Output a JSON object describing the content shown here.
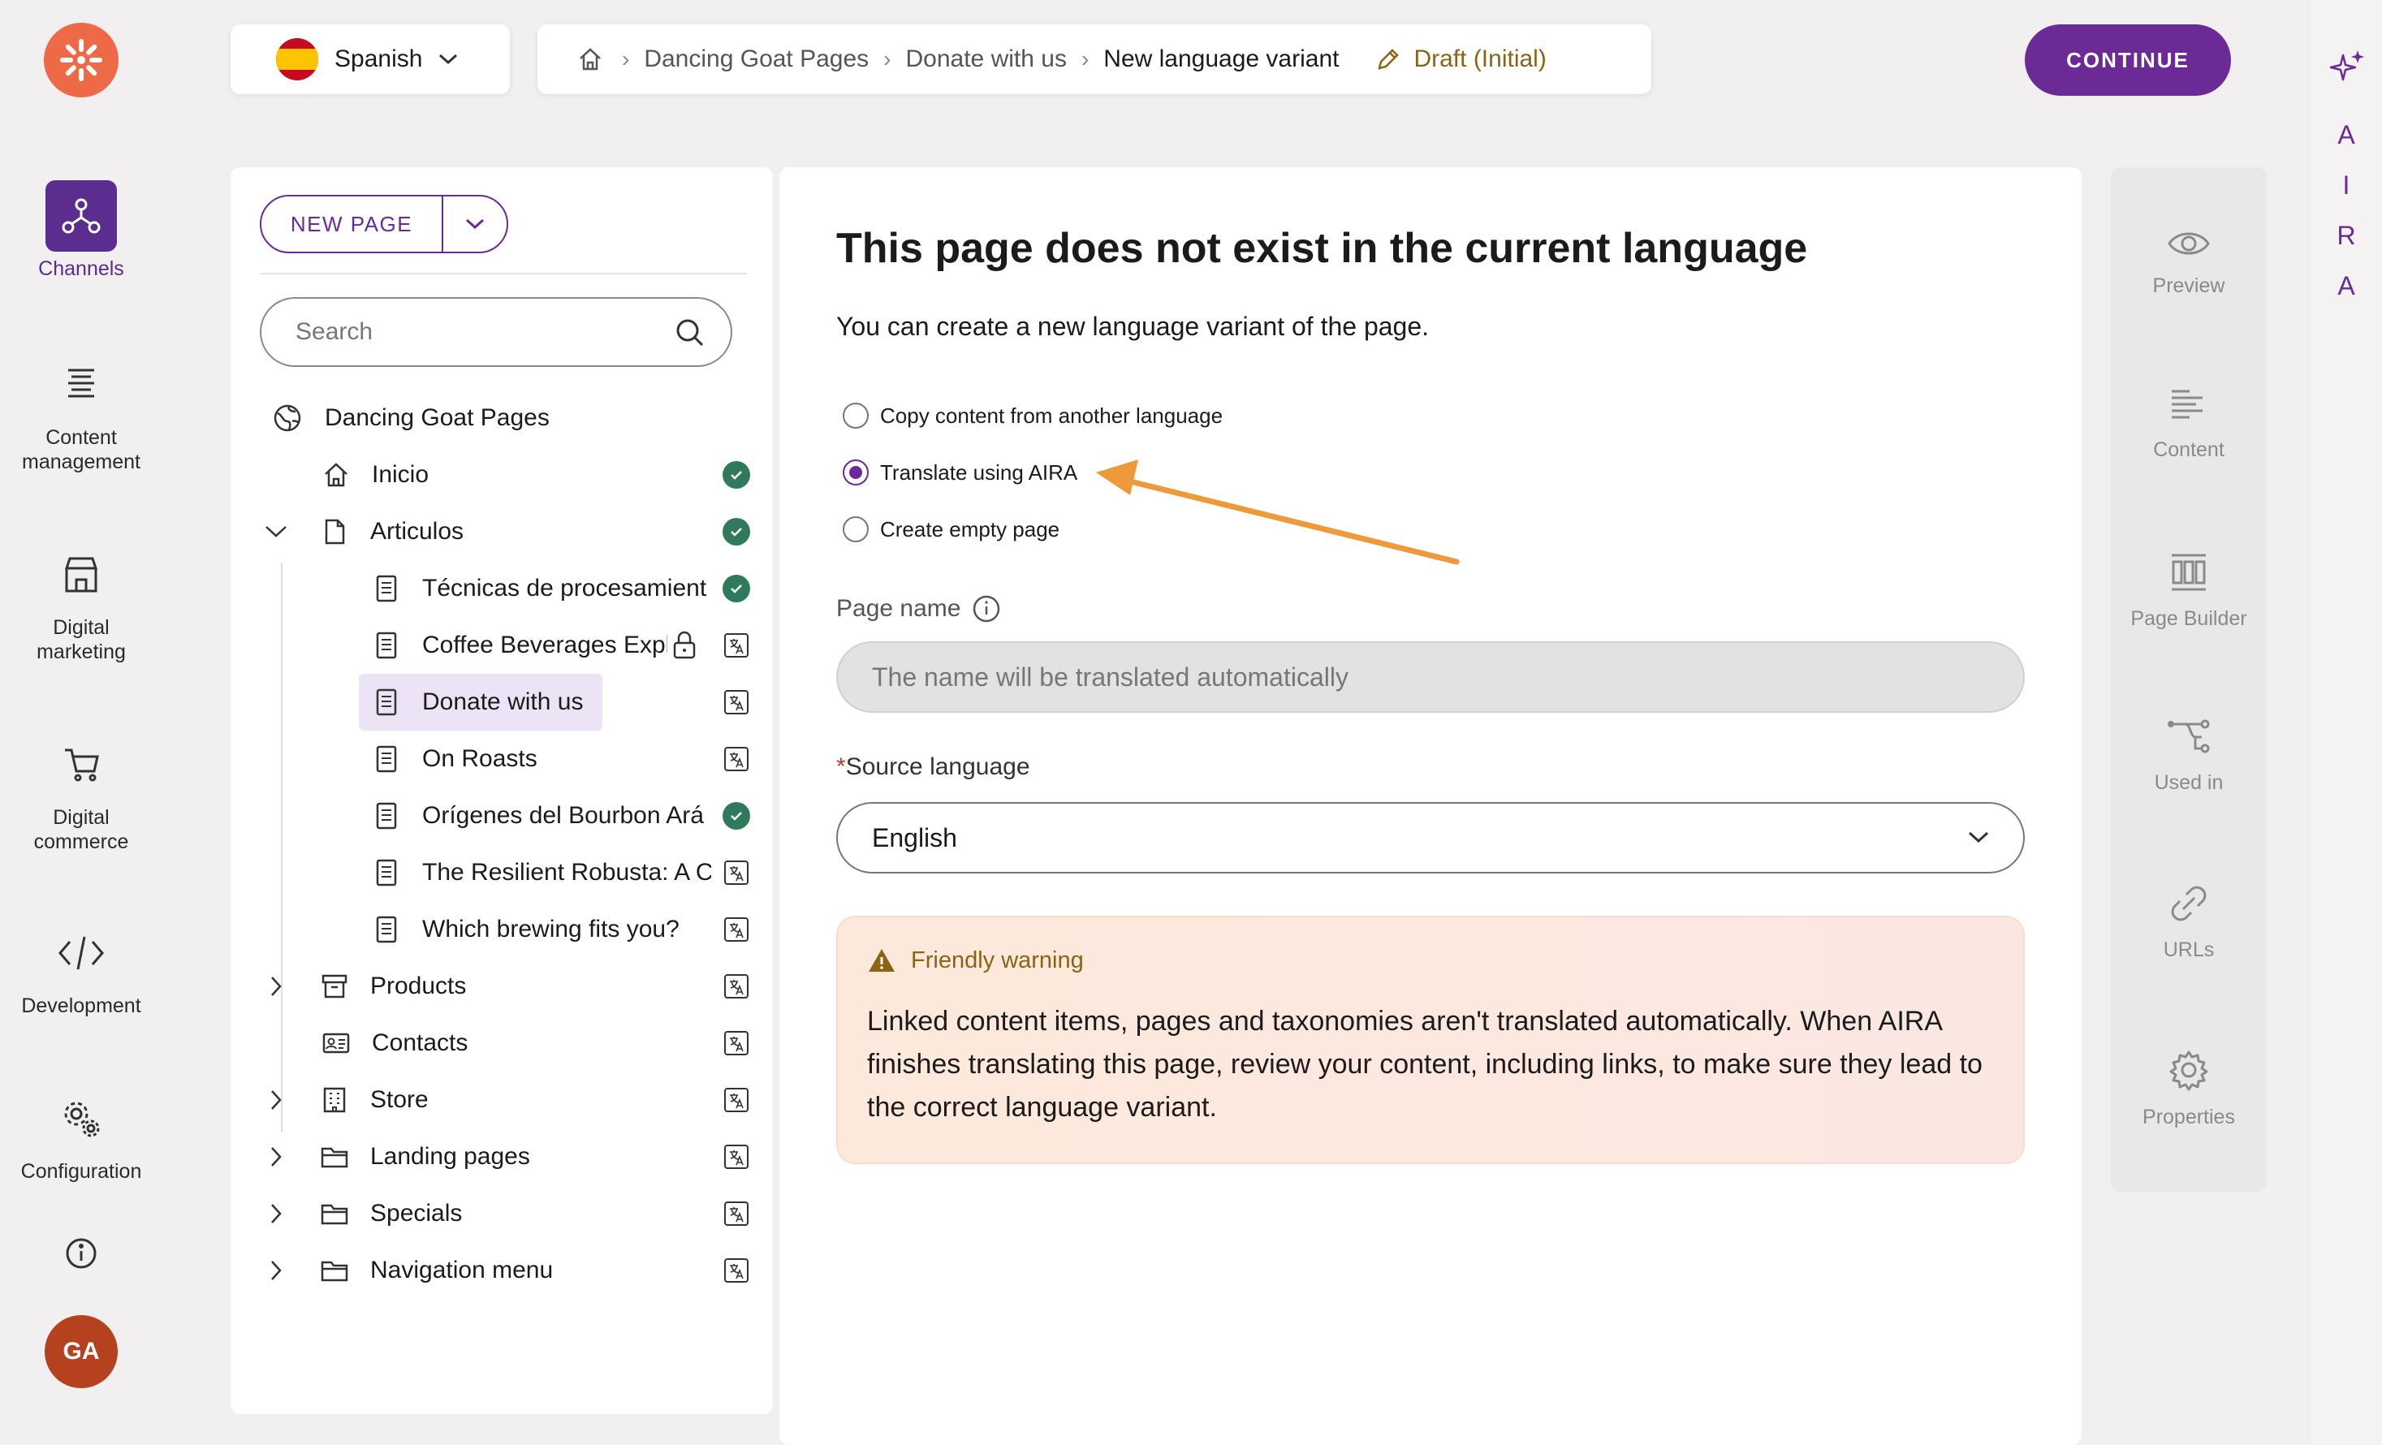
{
  "app": {
    "nav": [
      {
        "label": "Channels",
        "icon": "channels-icon",
        "active": true
      },
      {
        "label": "Content management",
        "icon": "content-management-icon",
        "active": false
      },
      {
        "label": "Digital marketing",
        "icon": "digital-marketing-icon",
        "active": false
      },
      {
        "label": "Digital commerce",
        "icon": "digital-commerce-icon",
        "active": false
      },
      {
        "label": "Development",
        "icon": "development-icon",
        "active": false
      },
      {
        "label": "Configuration",
        "icon": "configuration-icon",
        "active": false
      }
    ],
    "avatar_initials": "GA",
    "accent_color": "#6b2a96"
  },
  "topbar": {
    "language": "Spanish",
    "breadcrumb": [
      "Dancing Goat Pages",
      "Donate with us",
      "New language variant"
    ],
    "draft_status": "Draft (Initial)",
    "continue_label": "CONTINUE"
  },
  "tree": {
    "new_page_label": "NEW PAGE",
    "search_placeholder": "Search",
    "root_label": "Dancing Goat Pages",
    "items": [
      {
        "label": "Inicio",
        "status": "published"
      },
      {
        "label": "Articulos",
        "status": "published",
        "expanded": true
      },
      {
        "label": "Técnicas de procesamient",
        "status": "published"
      },
      {
        "label": "Coffee Beverages Expl",
        "status": "not-translated",
        "locked": true
      },
      {
        "label": "Donate with us",
        "status": "not-translated",
        "selected": true
      },
      {
        "label": "On Roasts",
        "status": "not-translated"
      },
      {
        "label": "Orígenes del Bourbon Ará",
        "status": "published"
      },
      {
        "label": "The Resilient Robusta: A C",
        "status": "not-translated"
      },
      {
        "label": "Which brewing fits you?",
        "status": "not-translated"
      },
      {
        "label": "Products",
        "status": "not-translated"
      },
      {
        "label": "Contacts",
        "status": "not-translated"
      },
      {
        "label": "Store",
        "status": "not-translated"
      },
      {
        "label": "Landing pages",
        "status": "not-translated"
      },
      {
        "label": "Specials",
        "status": "not-translated"
      },
      {
        "label": "Navigation menu",
        "status": "not-translated"
      }
    ]
  },
  "main": {
    "title": "This page does not exist in the current language",
    "subtitle": "You can create a new language variant of the page.",
    "options": [
      {
        "label": "Copy content from another language",
        "checked": false
      },
      {
        "label": "Translate using AIRA",
        "checked": true
      },
      {
        "label": "Create empty page",
        "checked": false
      }
    ],
    "page_name_label": "Page name",
    "page_name_placeholder": "The name will be translated automatically",
    "source_language_required_mark": "*",
    "source_language_label": "Source language",
    "source_language_value": "English",
    "warning_title": "Friendly warning",
    "warning_body": "Linked content items, pages and taxonomies aren't translated automatically. When AIRA finishes translating this page, review your content, including links, to make sure they lead to the correct language variant.",
    "annotation_arrow_color": "#ee9a3a"
  },
  "side_panel": [
    {
      "label": "Preview",
      "icon": "eye-icon"
    },
    {
      "label": "Content",
      "icon": "content-lines-icon"
    },
    {
      "label": "Page Builder",
      "icon": "page-builder-icon"
    },
    {
      "label": "Used in",
      "icon": "used-in-icon"
    },
    {
      "label": "URLs",
      "icon": "link-icon"
    },
    {
      "label": "Properties",
      "icon": "gear-icon"
    }
  ],
  "aira": {
    "letters": [
      "A",
      "I",
      "R",
      "A"
    ]
  }
}
